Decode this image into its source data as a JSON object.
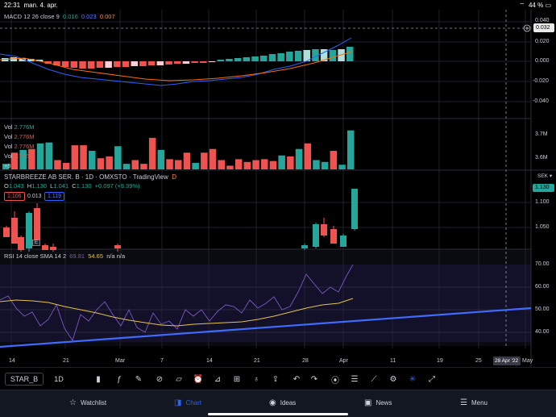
{
  "status": {
    "time": "22:31",
    "date": "man. 4. apr.",
    "battery": "44 %"
  },
  "macd": {
    "title": "MACD 12 26 close 9",
    "v1": "0.016",
    "v2": "0.023",
    "v3": "0.007",
    "ticks": [
      "0.040",
      "0.020",
      "0.000",
      "-0.020",
      "-0.040"
    ],
    "last": "0.032"
  },
  "volume": {
    "title": "Vol",
    "value": "2.776M",
    "overlay": [
      "Vol",
      "Vol",
      "Vol"
    ],
    "overlay_values": [
      "2.776M",
      "2.776M",
      "2.776M"
    ],
    "more": "+8",
    "ticks": [
      "3.7M",
      "3.6M"
    ]
  },
  "price": {
    "symbol_line": "STARBREEZE AB SER. B",
    "interval": "1D",
    "exchange": "OMXSTO",
    "source": "TradingView",
    "badge": "D",
    "o_label": "O",
    "o": "1.043",
    "h_label": "H",
    "h": "1.130",
    "l_label": "L",
    "l": "1.041",
    "c_label": "C",
    "c": "1.130",
    "change": "+0.097 (+9.39%)",
    "bid": "1.106",
    "spread": "0.013",
    "ask": "1.119",
    "currency": "SEK",
    "ticks": [
      "1.100",
      "1.050"
    ],
    "last": "1.130",
    "event_marker": "E"
  },
  "rsi": {
    "title": "RSI 14 close SMA 14 2",
    "rsi_value": "69.81",
    "sma_value": "54.65",
    "na1": "n/a",
    "na2": "n/a",
    "ticks": [
      "70.00",
      "60.00",
      "50.00",
      "40.00"
    ]
  },
  "time_axis": {
    "labels": [
      "14",
      "21",
      "Mar",
      "7",
      "14",
      "21",
      "28",
      "Apr",
      "11",
      "19",
      "25",
      "May"
    ],
    "cursor_label": "28 Apr '22"
  },
  "toolbar": {
    "symbol": "STAR_B",
    "symbol_sub": "",
    "interval": "1D"
  },
  "nav": {
    "items": [
      {
        "label": "Watchlist"
      },
      {
        "label": "Chart"
      },
      {
        "label": "Ideas"
      },
      {
        "label": "News"
      },
      {
        "label": "Menu"
      }
    ]
  },
  "colors": {
    "up": "#26a69a",
    "down": "#ef5350",
    "macd_line": "#2962ff",
    "signal_line": "#ff6d00",
    "rsi_line": "#7e57c2",
    "rsi_sma": "#e6c34a",
    "trend_line": "#3f6bff",
    "accent": "#2962ff"
  }
}
